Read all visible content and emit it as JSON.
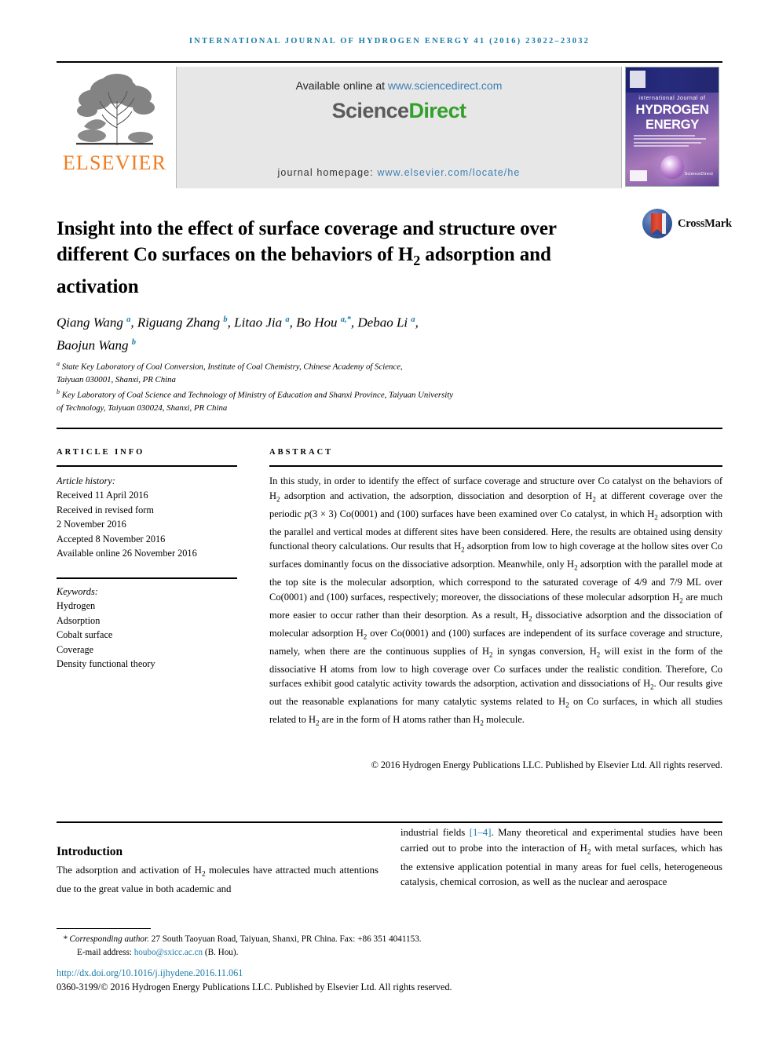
{
  "running_head": "International Journal of Hydrogen Energy 41 (2016) 23022–23032",
  "masthead": {
    "publisher_name": "ELSEVIER",
    "publisher_logo_name": "elsevier-tree-logo",
    "available_prefix": "Available online at ",
    "available_link": "www.sciencedirect.com",
    "sciencedirect_part1": "Science",
    "sciencedirect_part2": "Direct",
    "homepage_prefix": "journal homepage: ",
    "homepage_link": "www.elsevier.com/locate/he",
    "cover": {
      "line_small": "international Journal of",
      "line_big_1": "HYDROGEN",
      "line_big_2": "ENERGY",
      "footer_label": "ScienceDirect"
    }
  },
  "article": {
    "title": "Insight into the effect of surface coverage and structure over different Co surfaces on the behaviors of H2 adsorption and activation",
    "crossmark_label": "CrossMark",
    "authors_line_1": "Qiang Wang a, Riguang Zhang b, Litao Jia a, Bo Hou a,*, Debao Li a,",
    "authors_line_2": "Baojun Wang b",
    "affiliations": [
      "a State Key Laboratory of Coal Conversion, Institute of Coal Chemistry, Chinese Academy of Science, Taiyuan 030001, Shanxi, PR China",
      "b Key Laboratory of Coal Science and Technology of Ministry of Education and Shanxi Province, Taiyuan University of Technology, Taiyuan 030024, Shanxi, PR China"
    ]
  },
  "info": {
    "label": "ARTICLE INFO",
    "history_title": "Article history:",
    "history": [
      "Received 11 April 2016",
      "Received in revised form",
      "2 November 2016",
      "Accepted 8 November 2016",
      "Available online 26 November 2016"
    ],
    "keywords_title": "Keywords:",
    "keywords": [
      "Hydrogen",
      "Adsorption",
      "Cobalt surface",
      "Coverage",
      "Density functional theory"
    ]
  },
  "abstract": {
    "label": "ABSTRACT",
    "copyright": "© 2016 Hydrogen Energy Publications LLC. Published by Elsevier Ltd. All rights reserved."
  },
  "body": {
    "section_title": "Introduction",
    "left_text": "The adsorption and activation of H2 molecules have attracted much attentions due to the great value in both academic and",
    "right_text_pre": "industrial fields ",
    "right_citation": "[1–4]",
    "right_text_post": ". Many theoretical and experimental studies have been carried out to probe into the interaction of H2 with metal surfaces, which has the extensive application potential in many areas for fuel cells, heterogeneous catalysis, chemical corrosion, as well as the nuclear and aerospace"
  },
  "footer": {
    "corresponding_prefix": "* Corresponding author.",
    "corresponding_rest": " 27 South Taoyuan Road, Taiyuan, Shanxi, PR China. Fax: +86 351 4041153.",
    "email_label": "E-mail address: ",
    "email": "houbo@sxicc.ac.cn",
    "email_suffix": " (B. Hou).",
    "doi": "http://dx.doi.org/10.1016/j.ijhydene.2016.11.061",
    "issn_line": "0360-3199/© 2016 Hydrogen Energy Publications LLC. Published by Elsevier Ltd. All rights reserved."
  },
  "colors": {
    "journal_blue": "#1b7ba8",
    "elsevier_orange": "#f07c22",
    "sciencedirect_green": "#33a02c"
  }
}
